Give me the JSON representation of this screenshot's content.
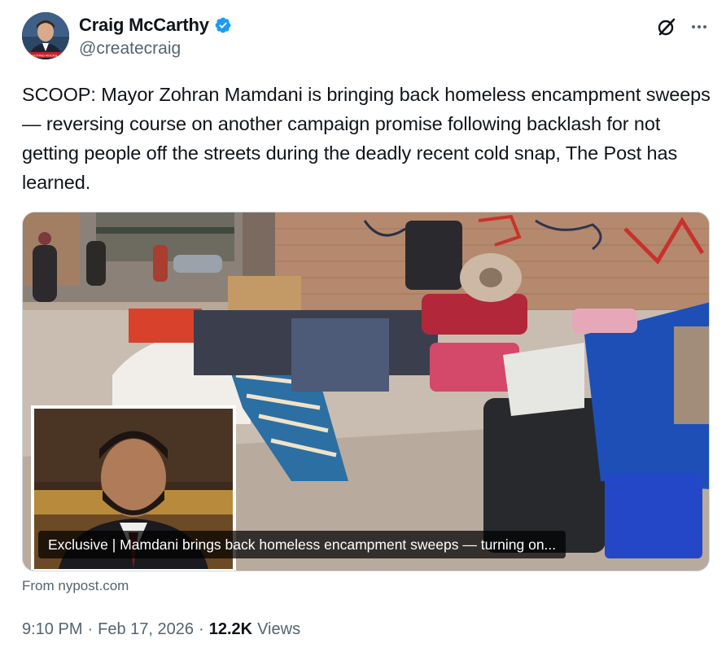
{
  "author": {
    "display_name": "Craig McCarthy",
    "handle": "@createcraig",
    "verified": true,
    "avatar_badge_text": "VOTING ROCKS",
    "avatar_icon": "profile-photo",
    "verified_icon": "verified-badge-icon"
  },
  "header_actions": {
    "grok_icon": "grok-icon",
    "more_icon": "more-options-icon"
  },
  "tweet": {
    "text": "SCOOP: Mayor Zohran Mamdani is bringing back homeless encampment sweeps — reversing course on another campaign promise following backlash for not getting people off the streets during the deadly recent cold snap, The Post has learned."
  },
  "card": {
    "title": "Exclusive | Mamdani brings back homeless encampment sweeps — turning on...",
    "source": "From nypost.com"
  },
  "meta": {
    "time": "9:10 PM",
    "date": "Feb 17, 2026",
    "views_count": "12.2K",
    "views_label": "Views",
    "separator": "·"
  },
  "colors": {
    "text_primary": "#0f1419",
    "text_secondary": "#536471",
    "verified_blue": "#1d9bf0",
    "border": "#cfd9de"
  }
}
